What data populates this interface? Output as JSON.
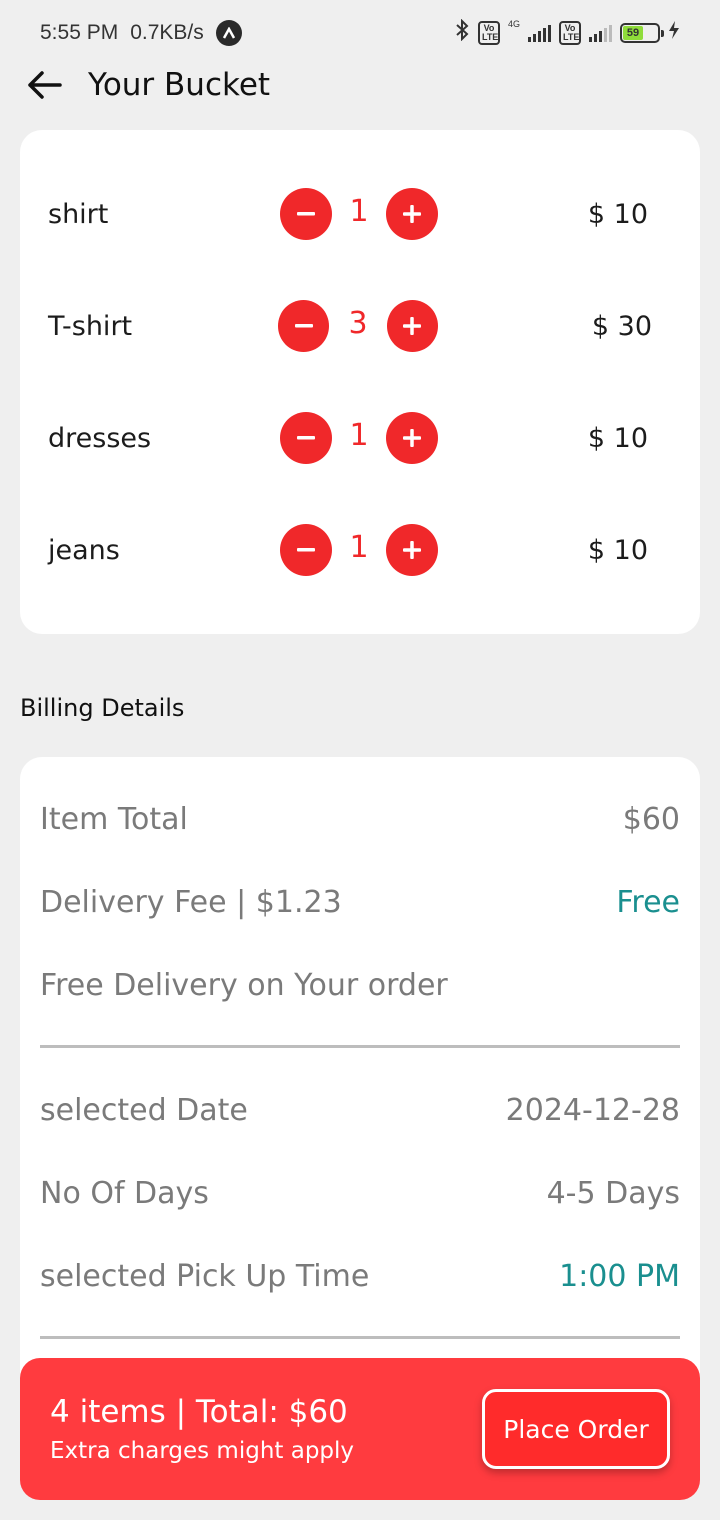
{
  "status_bar": {
    "time": "5:55 PM",
    "net_speed": "0.7KB/s",
    "network_label": "4G",
    "volte_label": "Vo LTE",
    "battery": "59"
  },
  "header": {
    "title": "Your Bucket"
  },
  "cart": {
    "items": [
      {
        "name": "shirt",
        "qty": "1",
        "price": "$ 10"
      },
      {
        "name": "T-shirt",
        "qty": "3",
        "price": "$ 30"
      },
      {
        "name": "dresses",
        "qty": "1",
        "price": "$ 10"
      },
      {
        "name": "jeans",
        "qty": "1",
        "price": "$ 10"
      }
    ]
  },
  "billing": {
    "title": "Billing Details",
    "item_total_label": "Item Total",
    "item_total_value": "$60",
    "delivery_fee_label": "Delivery Fee | $1.23",
    "delivery_fee_value": "Free",
    "free_delivery_note": "Free Delivery on Your order",
    "date_label": "selected Date",
    "date_value": "2024-12-28",
    "days_label": "No Of Days",
    "days_value": "4-5 Days",
    "pickup_label": "selected Pick Up Time",
    "pickup_value": "1:00 PM"
  },
  "order_bar": {
    "summary": "4 items | Total: $60",
    "note": "Extra charges might apply",
    "place_order_label": "Place Order"
  },
  "colors": {
    "accent_red": "#f0282a",
    "order_bar": "#ff3b3f",
    "teal": "#1a8f8f"
  }
}
